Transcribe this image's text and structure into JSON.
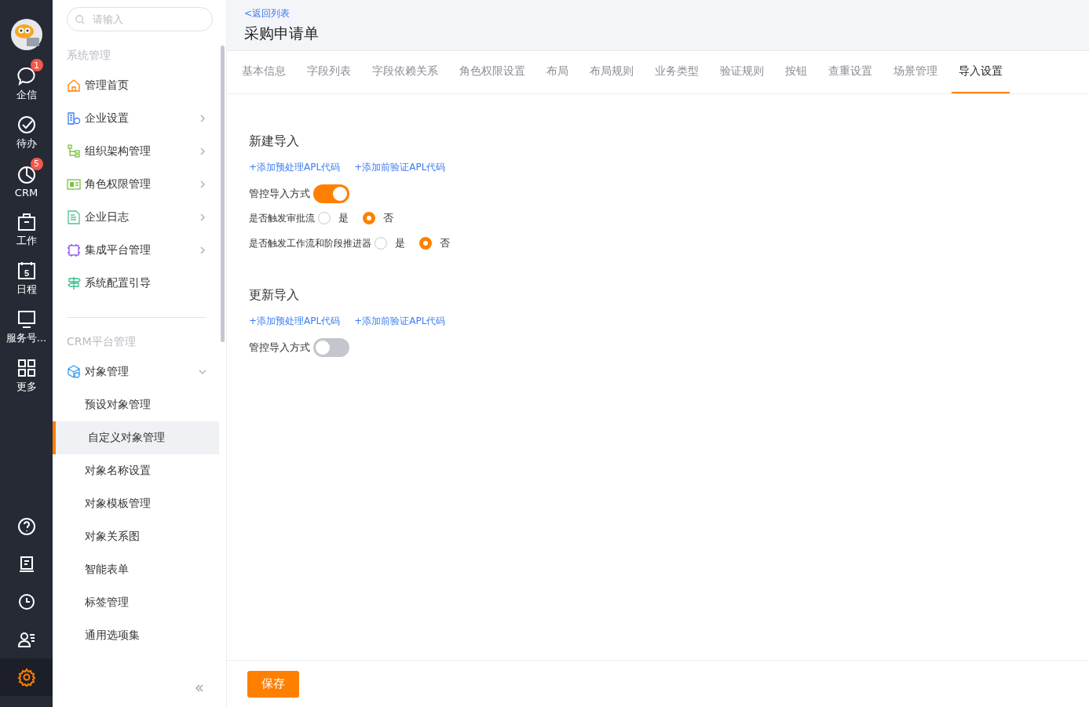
{
  "rail": {
    "items": [
      {
        "label": "企信",
        "badge": "1",
        "selected": false
      },
      {
        "label": "待办",
        "selected": false
      },
      {
        "label": "CRM",
        "badge": "5",
        "selected": false
      },
      {
        "label": "工作",
        "selected": false
      },
      {
        "label": "日程",
        "icon_text": "5",
        "selected": false
      },
      {
        "label": "服务号...",
        "selected": false
      },
      {
        "label": "更多",
        "selected": false
      }
    ],
    "bottom": [
      {
        "selected": false
      },
      {
        "selected": false
      },
      {
        "selected": false
      },
      {
        "selected": false
      },
      {
        "selected": true
      }
    ]
  },
  "sidebar": {
    "search": {
      "placeholder": "请输入"
    },
    "sections": [
      {
        "title": "系统管理",
        "items": [
          {
            "label": "管理首页"
          },
          {
            "label": "企业设置",
            "expanded": false
          },
          {
            "label": "组织架构管理",
            "expanded": false
          },
          {
            "label": "角色权限管理",
            "expanded": false
          },
          {
            "label": "企业日志",
            "expanded": false
          },
          {
            "label": "集成平台管理",
            "expanded": false
          },
          {
            "label": "系统配置引导"
          }
        ]
      },
      {
        "title": "CRM平台管理",
        "items": [
          {
            "label": "对象管理",
            "expanded": true,
            "children": [
              {
                "label": "预设对象管理",
                "selected": false
              },
              {
                "label": "自定义对象管理",
                "selected": true
              },
              {
                "label": "对象名称设置",
                "selected": false
              },
              {
                "label": "对象模板管理",
                "selected": false
              },
              {
                "label": "对象关系图",
                "selected": false
              },
              {
                "label": "智能表单",
                "selected": false
              },
              {
                "label": "标签管理",
                "selected": false
              },
              {
                "label": "通用选项集",
                "selected": false
              }
            ]
          }
        ]
      }
    ]
  },
  "header": {
    "back_link": "<返回列表",
    "title": "采购申请单"
  },
  "tabs": [
    {
      "label": "基本信息",
      "selected": false
    },
    {
      "label": "字段列表",
      "selected": false
    },
    {
      "label": "字段依赖关系",
      "selected": false
    },
    {
      "label": "角色权限设置",
      "selected": false
    },
    {
      "label": "布局",
      "selected": false
    },
    {
      "label": "布局规则",
      "selected": false
    },
    {
      "label": "业务类型",
      "selected": false
    },
    {
      "label": "验证规则",
      "selected": false
    },
    {
      "label": "按钮",
      "selected": false
    },
    {
      "label": "查重设置",
      "selected": false
    },
    {
      "label": "场景管理",
      "selected": false
    },
    {
      "label": "导入设置",
      "selected": true
    }
  ],
  "sections": [
    {
      "title": "新建导入",
      "links": [
        "+添加预处理APL代码",
        "+添加前验证APL代码"
      ],
      "toggle": {
        "label": "管控导入方式",
        "on": true
      },
      "radio_groups": [
        {
          "label": "是否触发审批流",
          "options": [
            {
              "label": "是",
              "selected": false
            },
            {
              "label": "否",
              "selected": true
            }
          ]
        },
        {
          "label": "是否触发工作流和阶段推进器",
          "options": [
            {
              "label": "是",
              "selected": false
            },
            {
              "label": "否",
              "selected": true
            }
          ]
        }
      ]
    },
    {
      "title": "更新导入",
      "links": [
        "+添加预处理APL代码",
        "+添加前验证APL代码"
      ],
      "toggle": {
        "label": "管控导入方式",
        "on": false
      }
    }
  ],
  "footer": {
    "save_button": "保存"
  }
}
